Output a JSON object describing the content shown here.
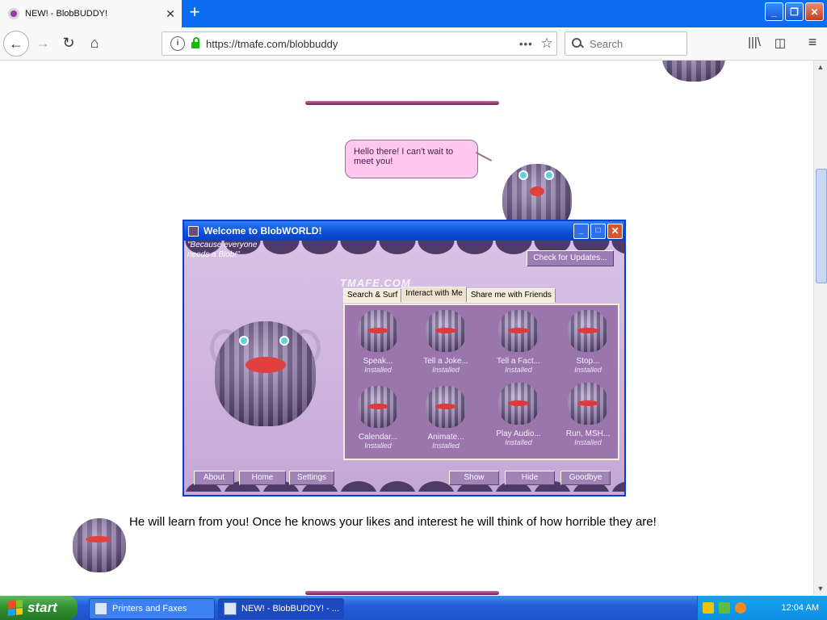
{
  "browser": {
    "tab_title": "NEW! - BlobBUDDY!",
    "tab_close": "✕",
    "new_tab": "+",
    "url": "https://tmafe.com/blobbuddy",
    "search_placeholder": "Search",
    "page_actions": "•••",
    "bookmark_star": "☆",
    "back": "←",
    "forward": "→",
    "reload": "↻",
    "home": "⌂",
    "library": "|||\\",
    "sidebar": "◫",
    "menu": "≡"
  },
  "page": {
    "speech_bubble": "Hello there! I can't wait to meet you!",
    "learn_text": "He will learn from you! Once he knows your likes and interest he will think of how horrible they are!"
  },
  "blobworld": {
    "title": "Welcome to BlobWORLD!",
    "motto": "\"Because everyone needs a Blob!\"",
    "check_updates": "Check for Updates...",
    "brand": "TMAFE.COM",
    "tabs": [
      "Search & Surf",
      "Interact with Me",
      "Share me with Friends"
    ],
    "actions": [
      {
        "label": "Speak...",
        "status": "Installed"
      },
      {
        "label": "Tell a Joke...",
        "status": "Installed"
      },
      {
        "label": "Tell a Fact...",
        "status": "Installed"
      },
      {
        "label": "Stop...",
        "status": "Installed"
      },
      {
        "label": "Calendar...",
        "status": "Installed"
      },
      {
        "label": "Animate...",
        "status": "Installed"
      },
      {
        "label": "Play Audio...",
        "status": "Installed"
      },
      {
        "label": "Run, MSH...",
        "status": "Installed"
      }
    ],
    "buttons": {
      "about": "About",
      "home": "Home",
      "settings": "Settings",
      "show": "Show",
      "hide": "Hide",
      "goodbye": "Goodbye"
    }
  },
  "taskbar": {
    "start": "start",
    "items": [
      "Printers and Faxes",
      "NEW! - BlobBUDDY! - ..."
    ],
    "clock": "12:04 AM"
  },
  "colors": {
    "firefox_tabstrip": "#0a6cf0",
    "xp_taskbar": "#245edb",
    "blob_purple": "#5d4a76",
    "speech_pink": "#ffc8ef"
  }
}
